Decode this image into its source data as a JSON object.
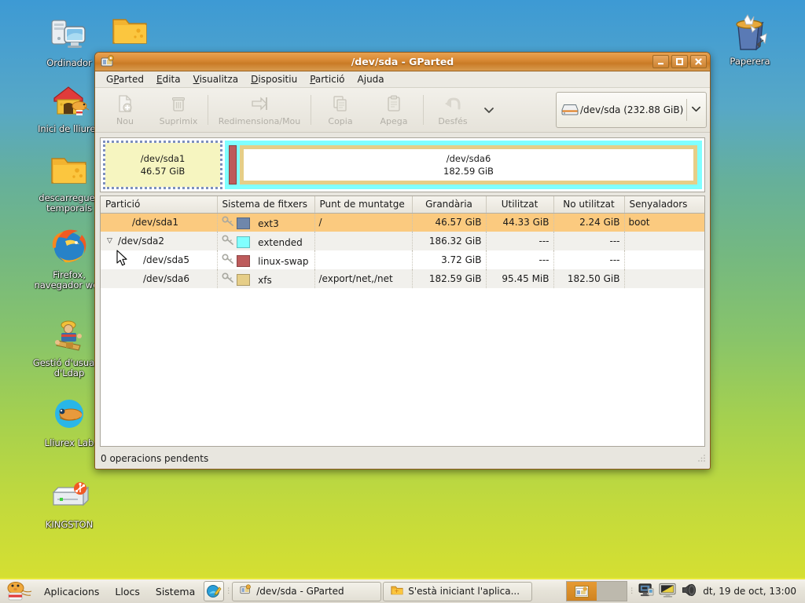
{
  "desktop": {
    "icons": [
      {
        "name": "ordinador",
        "label": "Ordinador",
        "icon": "computer-icon"
      },
      {
        "name": "folder-top",
        "label": "",
        "icon": "folder-icon"
      },
      {
        "name": "inici-de-lliurex",
        "label": "Inici de lliurex",
        "icon": "home-house-icon"
      },
      {
        "name": "descarregues-temporals",
        "label": "descarregues temporals",
        "icon": "folder-icon"
      },
      {
        "name": "firefox",
        "label": "Firefox, navegador web",
        "icon": "firefox-icon"
      },
      {
        "name": "gestio-usuaris-ldap",
        "label": "Gestió d'usuaris d'Ldap",
        "icon": "ldap-users-icon"
      },
      {
        "name": "lliurex-lab",
        "label": "Lliurex Lab",
        "icon": "lliurex-lab-icon"
      },
      {
        "name": "kingston",
        "label": "KINGSTON",
        "icon": "usb-drive-icon"
      },
      {
        "name": "paperera",
        "label": "Paperera",
        "icon": "trash-icon"
      }
    ]
  },
  "window": {
    "title": "/dev/sda - GParted",
    "titlebar_icon": "gparted-icon",
    "buttons": {
      "minimize": "minimize-icon",
      "maximize": "maximize-icon",
      "close": "close-icon"
    },
    "menu": [
      {
        "pre": "G",
        "mnemonic": "P",
        "post": "arted",
        "name": "menu-gparted"
      },
      {
        "pre": "",
        "mnemonic": "E",
        "post": "dita",
        "name": "menu-edita"
      },
      {
        "pre": "",
        "mnemonic": "V",
        "post": "isualitza",
        "name": "menu-visualitza"
      },
      {
        "pre": "",
        "mnemonic": "D",
        "post": "ispositiu",
        "name": "menu-dispositiu"
      },
      {
        "pre": "",
        "mnemonic": "P",
        "post": "artició",
        "name": "menu-particio"
      },
      {
        "pre": "A",
        "mnemonic": "j",
        "post": "uda",
        "name": "menu-ajuda"
      }
    ],
    "toolbar": {
      "new_label": "Nou",
      "delete_label": "Suprimix",
      "resize_label": "Redimensiona/Mou",
      "copy_label": "Copia",
      "paste_label": "Apega",
      "undo_label": "Desfés",
      "overflow_icon": "chevron-down-icon"
    },
    "device_selector": {
      "icon": "harddisk-icon",
      "label": "/dev/sda  (232.88 GiB)",
      "arrow_icon": "chevron-down-icon"
    },
    "graph": {
      "sda1": {
        "name": "/dev/sda1",
        "size": "46.57 GiB",
        "color": "#f6f5c0",
        "border": "#7c8fbe"
      },
      "extended": {
        "color": "#80ffff"
      },
      "swap": {
        "color": "#bd5b5b"
      },
      "sda6": {
        "name": "/dev/sda6",
        "size": "182.59 GiB",
        "border": "#e6ce87"
      }
    },
    "table": {
      "headers": [
        "Partició",
        "Sistema de fitxers",
        "Punt de muntatge",
        "Grandària",
        "Utilitzat",
        "No utilitzat",
        "Senyaladors"
      ],
      "rows": [
        {
          "partition": "/dev/sda1",
          "filesystem": "ext3",
          "fs_color": "#6f87ab",
          "mountpoint": "/",
          "size": "46.57 GiB",
          "used": "44.33 GiB",
          "unused": "2.24 GiB",
          "flags": "boot",
          "selected": true,
          "indent": 1,
          "expander": "",
          "key_icon": "key-icon"
        },
        {
          "partition": "/dev/sda2",
          "filesystem": "extended",
          "fs_color": "#80ffff",
          "mountpoint": "",
          "size": "186.32 GiB",
          "used": "---",
          "unused": "---",
          "flags": "",
          "selected": false,
          "indent": 0,
          "expander": "▽",
          "key_icon": "key-icon"
        },
        {
          "partition": "/dev/sda5",
          "filesystem": "linux-swap",
          "fs_color": "#bd5b5b",
          "mountpoint": "",
          "size": "3.72 GiB",
          "used": "---",
          "unused": "---",
          "flags": "",
          "selected": false,
          "indent": 2,
          "expander": "",
          "key_icon": "key-icon"
        },
        {
          "partition": "/dev/sda6",
          "filesystem": "xfs",
          "fs_color": "#e6ce87",
          "mountpoint": "/export/net,/net",
          "size": "182.59 GiB",
          "used": "95.45 MiB",
          "unused": "182.50 GiB",
          "flags": "",
          "selected": false,
          "indent": 2,
          "expander": "",
          "key_icon": "key-icon"
        }
      ]
    },
    "status": "0 operacions pendents"
  },
  "taskbar": {
    "menus": [
      {
        "label": "Aplicacions",
        "name": "menu-aplicacions"
      },
      {
        "label": "Llocs",
        "name": "menu-llocs"
      },
      {
        "label": "Sistema",
        "name": "menu-sistema"
      }
    ],
    "launcher_icon": "text-editor-icon",
    "tasks": [
      {
        "label": "/dev/sda - GParted",
        "icon": "gparted-icon",
        "active": true
      },
      {
        "label": "S'està iniciant l'aplica...",
        "icon": "folder-icon",
        "active": false
      }
    ],
    "workspaces": [
      {
        "name": "workspace-1",
        "active": true
      },
      {
        "name": "workspace-2",
        "active": false
      }
    ],
    "tray_icons": [
      "network-monitor-icon",
      "display-icon",
      "volume-icon"
    ],
    "clock": "dt, 19 de oct, 13:00"
  },
  "colors": {
    "accent": "#d98a35",
    "selection": "#fbca7f",
    "taskbar_top_border": "#e9e93c"
  }
}
